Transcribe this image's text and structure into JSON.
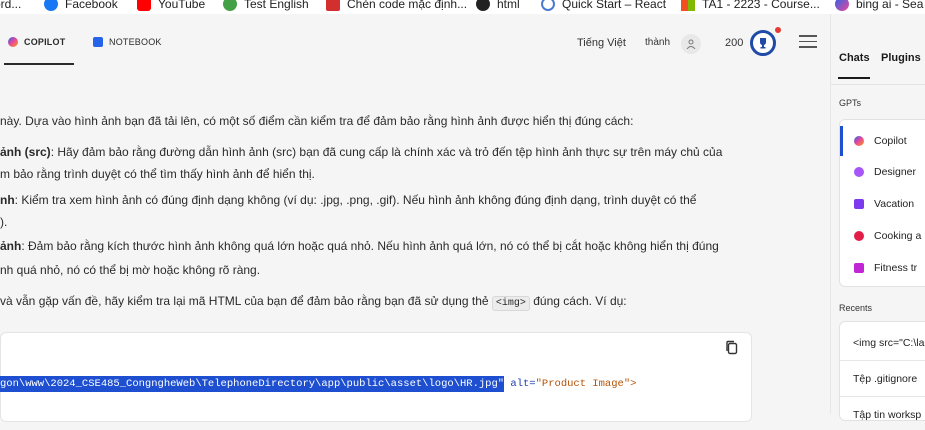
{
  "bookmarks": [
    {
      "label": "ord...",
      "icon": "globe-icon"
    },
    {
      "label": "Facebook",
      "icon": "facebook-icon"
    },
    {
      "label": "YouTube",
      "icon": "youtube-icon"
    },
    {
      "label": "Test English",
      "icon": "check-icon"
    },
    {
      "label": "Chèn code mặc định...",
      "icon": "bookmark-icon"
    },
    {
      "label": "html",
      "icon": "github-icon"
    },
    {
      "label": "Quick Start – React",
      "icon": "react-icon"
    },
    {
      "label": "TA1 - 2223 - Course...",
      "icon": "windows-icon"
    },
    {
      "label": "bing ai - Sea",
      "icon": "copilot-icon"
    }
  ],
  "header": {
    "tabs": [
      {
        "label": "COPILOT",
        "icon": "copilot-icon",
        "active": true
      },
      {
        "label": "NOTEBOOK",
        "icon": "notebook-icon",
        "active": false
      }
    ],
    "language": "Tiếng Việt",
    "username": "thành",
    "points": "200"
  },
  "chat": {
    "intro": "này. Dựa vào hình ảnh bạn đã tải lên, có một số điểm cần kiểm tra để đảm bảo rằng hình ảnh được hiển thị đúng cách:",
    "point1_bold": "ảnh (src)",
    "point1_text": ": Hãy đảm bảo rằng đường dẫn hình ảnh (src) bạn đã cung cấp là chính xác và trỏ đến tệp hình ảnh thực sự trên máy chủ của",
    "point1_cont": "m bảo rằng trình duyệt có thể tìm thấy hình ảnh để hiển thị.",
    "point2_bold": "nh",
    "point2_text": ": Kiểm tra xem hình ảnh có đúng định dạng không (ví dụ: .jpg, .png, .gif). Nếu hình ảnh không đúng định dạng, trình duyệt có thể",
    "point2_cont": ").",
    "point3_bold": "ảnh",
    "point3_text": ": Đảm bảo rằng kích thước hình ảnh không quá lớn hoặc quá nhỏ. Nếu hình ảnh quá lớn, nó có thể bị cắt hoặc không hiển thị đúng",
    "point3_cont": "nh quá nhỏ, nó có thể bị mờ hoặc không rõ ràng.",
    "closing_before": " và vẫn gặp vấn đề, hãy kiểm tra lại mã HTML của bạn để đảm bảo rằng bạn đã sử dụng thẻ ",
    "closing_code": "<img>",
    "closing_after": " đúng cách. Ví dụ:",
    "code_highlight": "gon\\www\\2024_CSE485_CongngheWeb\\TelephoneDirectory\\app\\public\\asset\\logo\\HR.jpg\"",
    "code_attr": " alt=",
    "code_value": "\"Product Image\">"
  },
  "sidebar": {
    "tabs": [
      "Chats",
      "Plugins"
    ],
    "gpts_label": "GPTs",
    "gpts": [
      {
        "label": "Copilot",
        "color": "#8b5cf6"
      },
      {
        "label": "Designer",
        "color": "#a855f7"
      },
      {
        "label": "Vacation",
        "color": "#7c3aed"
      },
      {
        "label": "Cooking a",
        "color": "#e11d48"
      },
      {
        "label": "Fitness tr",
        "color": "#c026d3"
      }
    ],
    "recents_label": "Recents",
    "recents": [
      "<img src=\"C:\\la",
      "Tệp .gitignore",
      "Tập tin worksp"
    ]
  },
  "colors": {
    "accent": "#1d4fd0",
    "trophy": "#1f4aa8"
  }
}
